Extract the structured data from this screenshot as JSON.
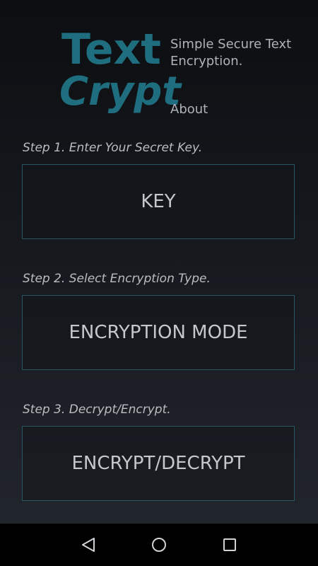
{
  "app": {
    "logo_line1": "Text",
    "logo_line2": "Crypt",
    "tagline": "Simple Secure Text Encryption.",
    "about_label": "About"
  },
  "steps": [
    {
      "label": "Step 1. Enter Your Secret Key.",
      "button": "KEY"
    },
    {
      "label": "Step 2. Select Encryption Type.",
      "button": "ENCRYPTION MODE"
    },
    {
      "label": "Step 3. Decrypt/Encrypt.",
      "button": "ENCRYPT/DECRYPT"
    }
  ],
  "navbar": {
    "back_icon": "back-triangle",
    "home_icon": "home-circle",
    "recents_icon": "recents-square"
  },
  "colors": {
    "brand": "#1f6e7f",
    "button_border": "#2a5663",
    "text": "#c4c8cc",
    "navbar": "#000000"
  }
}
